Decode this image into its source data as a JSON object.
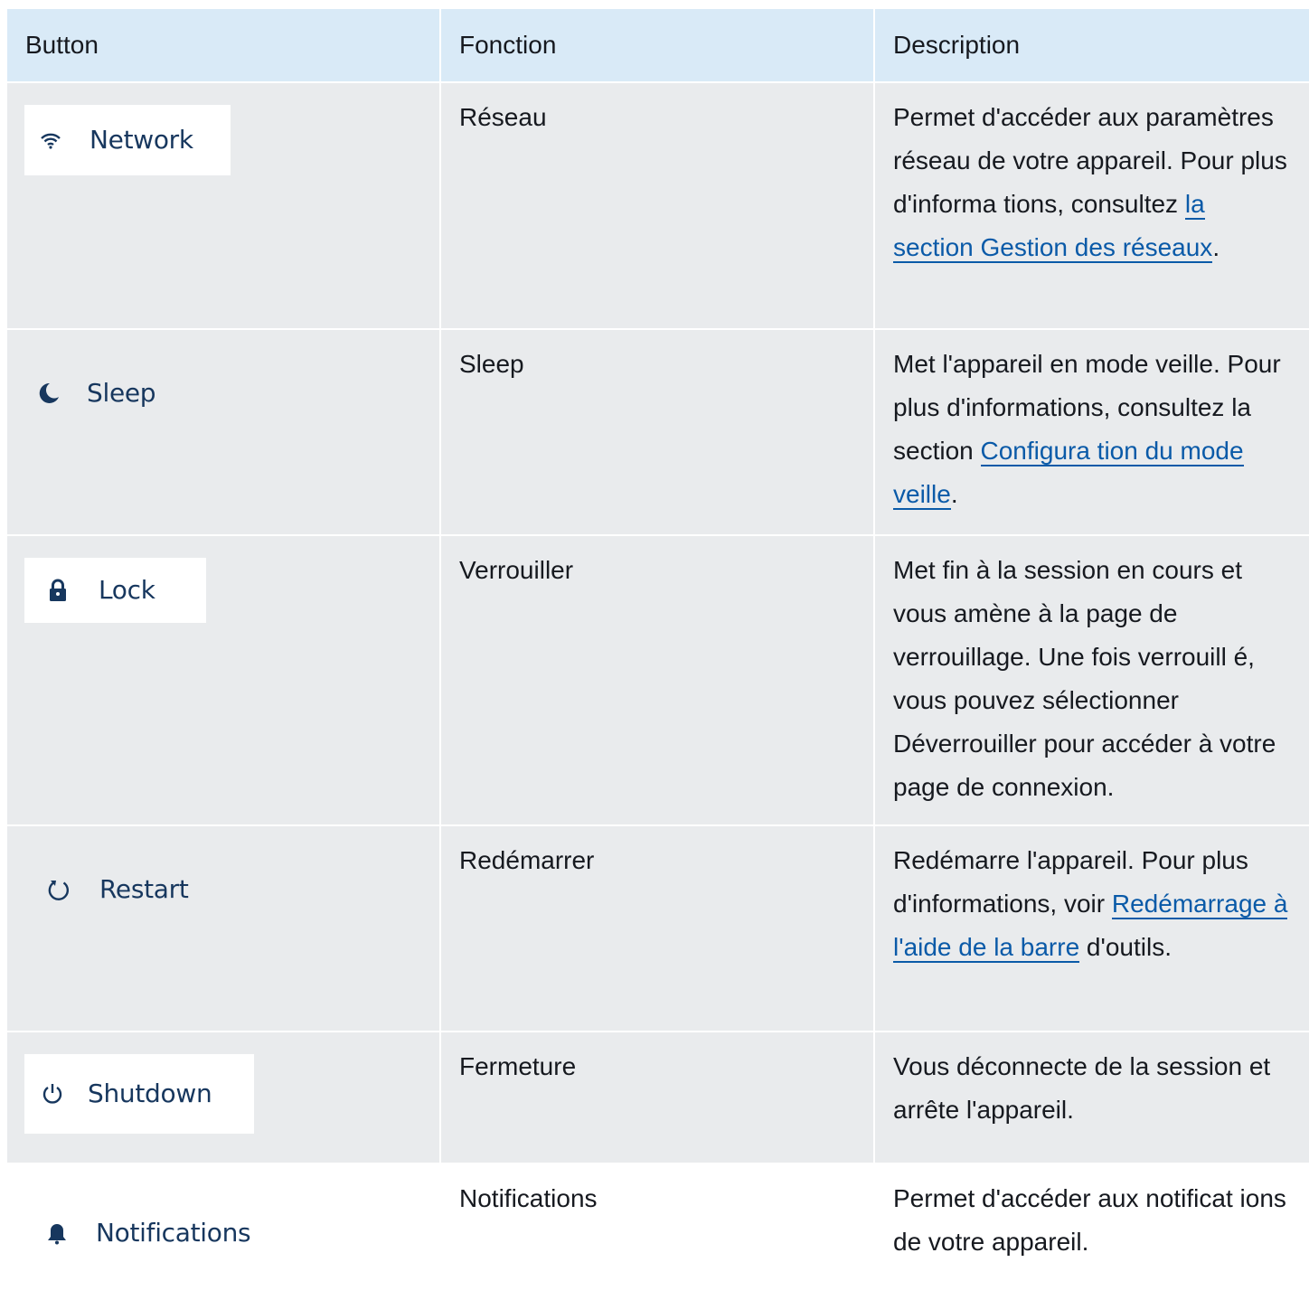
{
  "table": {
    "headers": [
      "Button",
      "Fonction",
      "Description"
    ],
    "rows": [
      {
        "button": {
          "label": "Network",
          "icon": "wifi-icon"
        },
        "fonction": "Réseau",
        "desc_before": "Permet d'accéder aux paramètres réseau de votre appareil. Pour plus d'informa tions, consultez ",
        "link": "la section Gestion des réseaux",
        "desc_after": "."
      },
      {
        "button": {
          "label": "Sleep",
          "icon": "moon-icon"
        },
        "fonction": "Sleep",
        "desc_before": "Met l'appareil en mode veille. Pour plus d'informations, consultez la section ",
        "link": "Configura tion du mode veille",
        "desc_after": "."
      },
      {
        "button": {
          "label": "Lock",
          "icon": "lock-icon"
        },
        "fonction": "Verrouiller",
        "desc_before": "Met fin à la session en cours et vous amène à la page de verrouillage. Une fois verrouill é, vous pouvez sélectionner Déverrouiller pour accéder à votre page de connexion.",
        "link": "",
        "desc_after": ""
      },
      {
        "button": {
          "label": "Restart",
          "icon": "restart-icon"
        },
        "fonction": "Redémarrer",
        "desc_before": "Redémarre l'appareil. Pour plus d'informations, voir ",
        "link": "Redémarrage à l'aide de la barre",
        "desc_after": " d'outils."
      },
      {
        "button": {
          "label": "Shutdown",
          "icon": "power-icon"
        },
        "fonction": "Fermeture",
        "desc_before": "Vous déconnecte de la session et arrête l'appareil.",
        "link": "",
        "desc_after": ""
      },
      {
        "button": {
          "label": "Notifications",
          "icon": "bell-icon"
        },
        "fonction": "Notifications",
        "desc_before": "Permet d'accéder aux notificat ions de votre appareil.",
        "link": "",
        "desc_after": ""
      }
    ]
  },
  "colors": {
    "header_bg": "#d9eaf7",
    "row_bg": "#e9ebed",
    "link": "#0a5aa8",
    "button_text": "#17375e"
  }
}
